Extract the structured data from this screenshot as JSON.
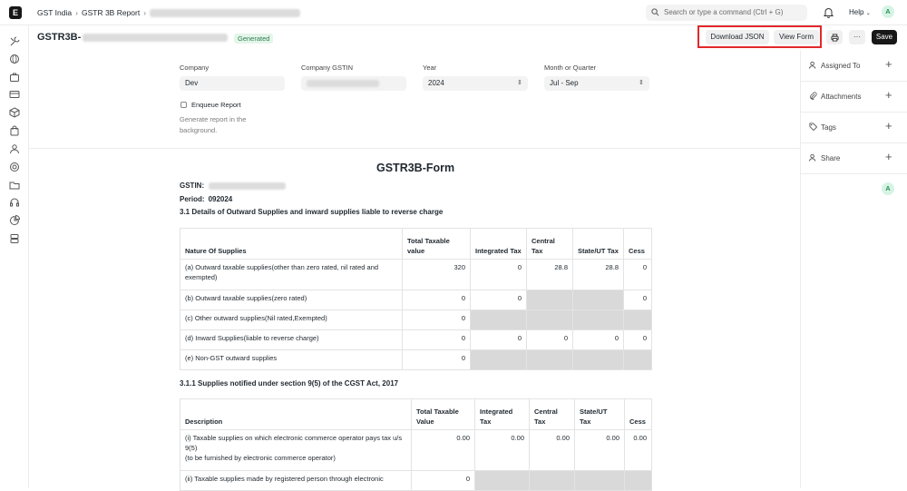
{
  "app": {
    "logo_letter": "E"
  },
  "breadcrumb": {
    "items": [
      "GST India",
      "GSTR 3B Report"
    ]
  },
  "search": {
    "placeholder": "Search or type a command (Ctrl + G)"
  },
  "header": {
    "help_label": "Help",
    "avatar_letter": "A"
  },
  "doc": {
    "title_prefix": "GSTR3B-",
    "status": "Generated"
  },
  "actions": {
    "download_json": "Download JSON",
    "view_form": "View Form",
    "more": "···",
    "save": "Save"
  },
  "form": {
    "company_label": "Company",
    "company_value": "Dev",
    "gstin_label": "Company GSTIN",
    "year_label": "Year",
    "year_value": "2024",
    "period_label": "Month or Quarter",
    "period_value": "Jul - Sep",
    "enqueue_label": "Enqueue Report",
    "enqueue_hint": "Generate report in the background."
  },
  "side": {
    "assigned_to": "Assigned To",
    "attachments": "Attachments",
    "tags": "Tags",
    "share": "Share",
    "avatar_letter": "A"
  },
  "report": {
    "title": "GSTR3B-Form",
    "gstin_label": "GSTIN:",
    "period_label": "Period:",
    "period_value": "092024",
    "section_3_1": "3.1  Details of Outward Supplies and inward supplies liable to reverse charge",
    "section_3_1_1": "3.1.1  Supplies notified under section 9(5) of the CGST Act, 2017",
    "table1": {
      "headers": [
        "Nature Of Supplies",
        "Total Taxable value",
        "Integrated Tax",
        "Central Tax",
        "State/UT Tax",
        "Cess"
      ],
      "rows": [
        {
          "label": "(a) Outward taxable supplies(other than zero rated, nil rated and exempted)",
          "total": "320",
          "igst": "0",
          "cgst": "28.8",
          "sgst": "28.8",
          "cess": "0"
        },
        {
          "label": "(b) Outward taxable supplies(zero rated)",
          "total": "0",
          "igst": "0",
          "cess": "0"
        },
        {
          "label": "(c) Other outward supplies(Nil rated,Exempted)",
          "total": "0"
        },
        {
          "label": "(d) Inward Supplies(liable to reverse charge)",
          "total": "0",
          "igst": "0",
          "cgst": "0",
          "sgst": "0",
          "cess": "0"
        },
        {
          "label": "(e) Non-GST outward supplies",
          "total": "0"
        }
      ]
    },
    "table2": {
      "headers": [
        "Description",
        "Total Taxable Value",
        "Integrated Tax",
        "Central Tax",
        "State/UT Tax",
        "Cess"
      ],
      "rows": [
        {
          "label_line1": "(i) Taxable supplies on which electronic commerce operator pays tax u/s 9(5)",
          "label_line2": "(to be furnished by electronic commerce operator)",
          "total": "0.00",
          "igst": "0.00",
          "cgst": "0.00",
          "sgst": "0.00",
          "cess": "0.00"
        },
        {
          "label": "(ii) Taxable supplies made by registered person through electronic",
          "total": "0"
        }
      ]
    }
  }
}
